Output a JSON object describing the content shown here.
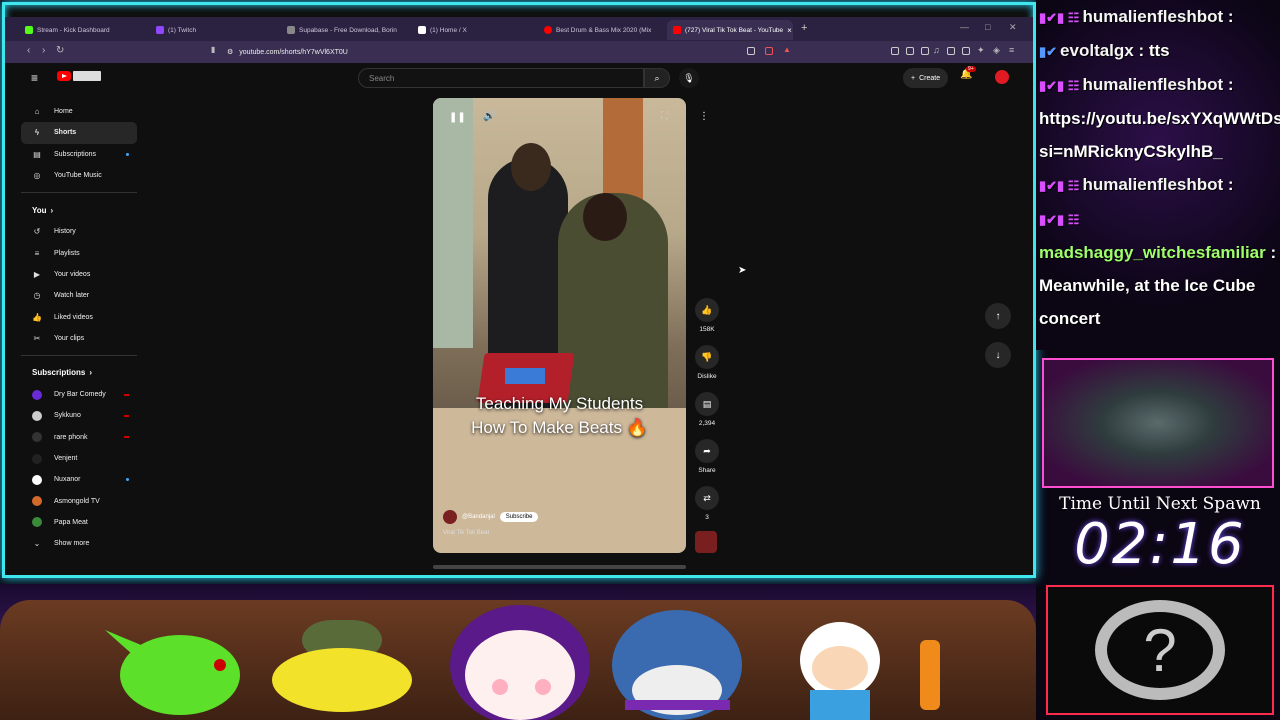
{
  "browser": {
    "tabs": [
      {
        "label": "Stream - Kick Dashboard",
        "color": "#53fc18"
      },
      {
        "label": "(1) Twitch",
        "color": "#9146ff"
      },
      {
        "label": "Supabase - Free Download, Borin",
        "color": "#888888"
      },
      {
        "label": "(1) Home / X",
        "color": "#ffffff"
      },
      {
        "label": "Best Drum & Bass Mix 2020 (Mix",
        "color": "#ff0000"
      },
      {
        "label": "(727) Viral Tik Tok Beat - YouTube",
        "color": "#ff0000"
      }
    ],
    "url": "youtube.com/shorts/hY7wVl6XT0U"
  },
  "youtube": {
    "search_placeholder": "Search",
    "create_label": "Create",
    "notif_badge": "9+",
    "sidebar": {
      "main": [
        {
          "label": "Home",
          "icon": "home-icon",
          "glyph": "⌂"
        },
        {
          "label": "Shorts",
          "icon": "shorts-icon",
          "glyph": "ϟ"
        },
        {
          "label": "Subscriptions",
          "icon": "subscriptions-icon",
          "glyph": "▤"
        },
        {
          "label": "YouTube Music",
          "icon": "music-icon",
          "glyph": "◎"
        }
      ],
      "you_label": "You",
      "you": [
        {
          "label": "History",
          "icon": "history-icon",
          "glyph": "↺"
        },
        {
          "label": "Playlists",
          "icon": "playlists-icon",
          "glyph": "≡"
        },
        {
          "label": "Your videos",
          "icon": "your-videos-icon",
          "glyph": "▶"
        },
        {
          "label": "Watch later",
          "icon": "watch-later-icon",
          "glyph": "◷"
        },
        {
          "label": "Liked videos",
          "icon": "liked-icon",
          "glyph": "👍"
        },
        {
          "label": "Your clips",
          "icon": "clips-icon",
          "glyph": "✂"
        }
      ],
      "subs_label": "Subscriptions",
      "subs": [
        {
          "label": "Dry Bar Comedy",
          "color": "#6a2ad8"
        },
        {
          "label": "Sykkuno",
          "color": "#cccccc"
        },
        {
          "label": "rare phonk",
          "color": "#333333"
        },
        {
          "label": "Venjent",
          "color": "#222222"
        },
        {
          "label": "Nuxanor",
          "color": "#ffffff"
        },
        {
          "label": "Asmongold TV",
          "color": "#d46a2a"
        },
        {
          "label": "Papa Meat",
          "color": "#3a8a3a"
        }
      ],
      "show_more": "Show more"
    },
    "video": {
      "caption_line1": "Teaching My Students",
      "caption_line2": "How To Make Beats 🔥",
      "channel": "@Bandanjal",
      "subscribe": "Subscribe",
      "title": "Viral Tik Tok Beat",
      "progress": 0.0
    },
    "actions": {
      "likes": "158K",
      "dislike": "Dislike",
      "comments": "2,394",
      "share": "Share",
      "remix": "3"
    }
  },
  "overlay": {
    "chat": [
      {
        "user": "humalienfleshbot",
        "message": ""
      },
      {
        "user": "evoltalgx",
        "message": "tts"
      },
      {
        "user": "humalienfleshbot",
        "message": ""
      },
      {
        "user": "",
        "message": "https://youtu.be/sxYXqWWtDs0?"
      },
      {
        "user": "",
        "message": "si=nMRicknyCSkylhB_"
      },
      {
        "user": "humalienfleshbot",
        "message": ""
      },
      {
        "user": "",
        "message": ""
      },
      {
        "user": "madshaggy_witchesfamiliar",
        "message": ""
      },
      {
        "user": "",
        "message": "Meanwhile, at the Ice Cube"
      },
      {
        "user": "",
        "message": "concert"
      }
    ],
    "spawn_title": "Time Until Next Spawn",
    "timer": "02:16"
  }
}
